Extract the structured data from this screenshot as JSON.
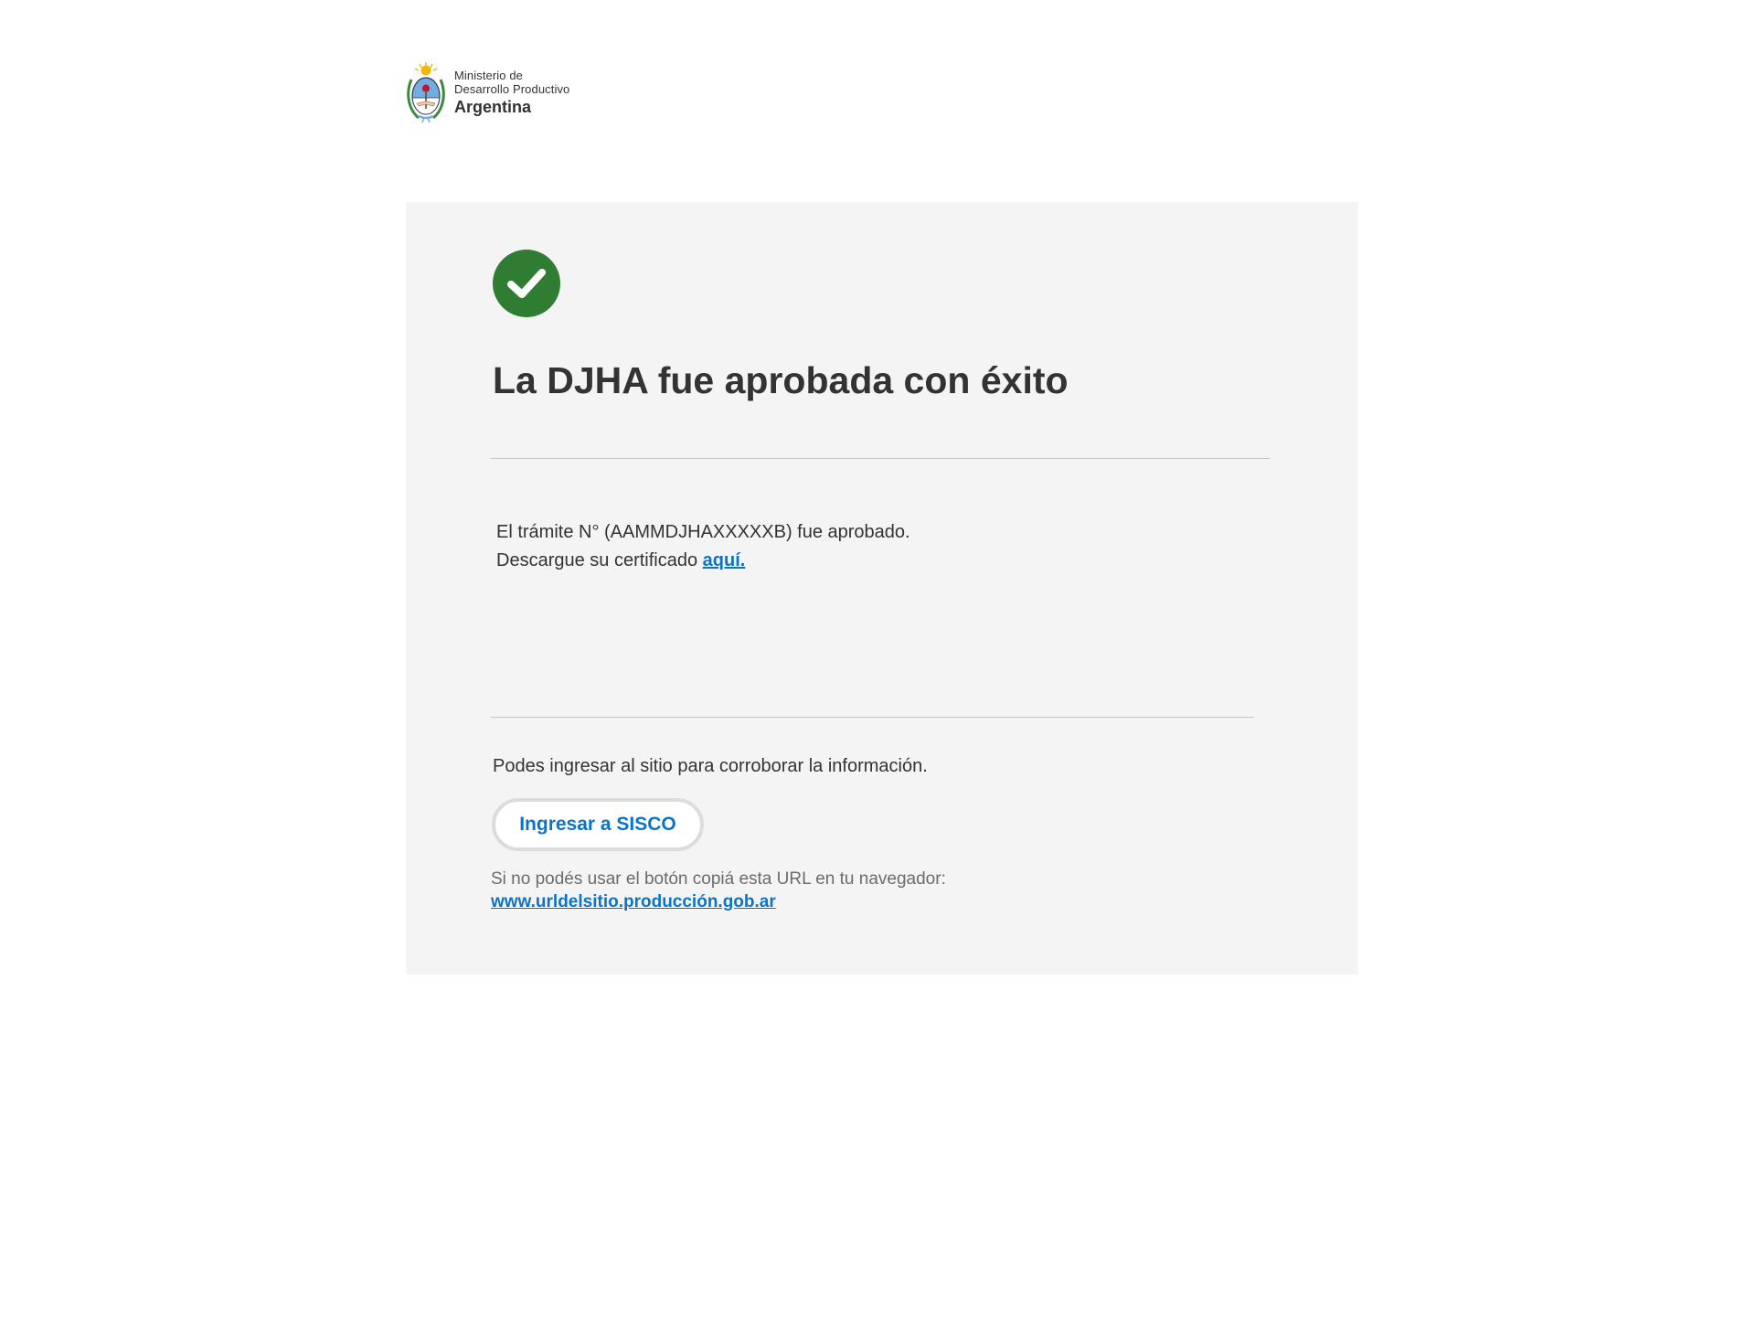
{
  "header": {
    "logo": {
      "icon": "argentina-coat-of-arms-icon",
      "line1": "Ministerio de",
      "line2": "Desarrollo Productivo",
      "line3": "Argentina"
    }
  },
  "card": {
    "status_icon": "check-circle-icon",
    "title": "La DJHA fue aprobada con éxito",
    "message": {
      "line1": "El trámite N° (AAMMDJHAXXXXXB) fue aprobado.",
      "line2_prefix": "Descargue su certificado ",
      "download_link": "aquí."
    },
    "info_text": "Podes ingresar al sitio para corroborar la información.",
    "button_label": "Ingresar a SISCO",
    "fallback_text": "Si no podés usar el botón copiá esta URL en tu navegador:",
    "fallback_url": "www.urldelsitio.producción.gob.ar"
  },
  "colors": {
    "card_background": "#f4f4f4",
    "success_green": "#2e7d32",
    "link_blue": "#0a74c9",
    "text_dark": "#333333",
    "text_muted": "#6b6b6b",
    "divider": "#c4c4c4"
  }
}
